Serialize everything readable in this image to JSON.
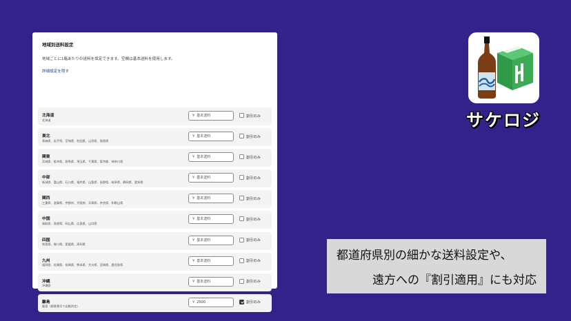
{
  "panel": {
    "title": "地域別送料設定",
    "description": "地域ごとに1箱あたりの送料を設定できます。空欄は基本送料を使用します。",
    "detail_link": "詳細設定を隠す",
    "currency_symbol": "¥",
    "checkbox_label": "割引のみ",
    "regions": [
      {
        "name": "北海道",
        "prefectures": "北海道",
        "placeholder": "基本送料",
        "value": "",
        "discount_only": false
      },
      {
        "name": "東北",
        "prefectures": "青森県、岩手県、宮城県、秋田県、山形県、福島県",
        "placeholder": "基本送料",
        "value": "",
        "discount_only": false
      },
      {
        "name": "関東",
        "prefectures": "茨城県、栃木県、群馬県、埼玉県、千葉県、東京都、神奈川県",
        "placeholder": "基本送料",
        "value": "",
        "discount_only": false
      },
      {
        "name": "中部",
        "prefectures": "新潟県、富山県、石川県、福井県、山梨県、長野県、岐阜県、静岡県、愛知県",
        "placeholder": "基本送料",
        "value": "",
        "discount_only": false
      },
      {
        "name": "関西",
        "prefectures": "三重県、滋賀県、京都府、大阪府、兵庫県、奈良県、和歌山県",
        "placeholder": "基本送料",
        "value": "",
        "discount_only": false
      },
      {
        "name": "中国",
        "prefectures": "鳥取県、島根県、岡山県、広島県、山口県",
        "placeholder": "基本送料",
        "value": "",
        "discount_only": false
      },
      {
        "name": "四国",
        "prefectures": "徳島県、香川県、愛媛県、高知県",
        "placeholder": "基本送料",
        "value": "",
        "discount_only": false
      },
      {
        "name": "九州",
        "prefectures": "福岡県、佐賀県、長崎県、熊本県、大分県、宮崎県、鹿児島県",
        "placeholder": "基本送料",
        "value": "",
        "discount_only": false
      },
      {
        "name": "沖縄",
        "prefectures": "沖縄県",
        "placeholder": "基本送料",
        "value": "",
        "discount_only": false
      },
      {
        "name": "離島",
        "prefectures": "離島（郵便番号で自動判定）",
        "placeholder": "基本送料",
        "value": "2500",
        "discount_only": true
      }
    ]
  },
  "brand": {
    "name": "サケロジ",
    "colors": {
      "bottle": "#7a3d16",
      "box": "#3daa55",
      "label": "#cfe3ef",
      "wave": "#1e5fa8"
    }
  },
  "caption": {
    "line1": "都道府県別の細かな送料設定や、",
    "line2": "遠方への『割引適用』にも対応"
  },
  "colors": {
    "background": "#33228a",
    "link": "#2a3f9e",
    "caption_bg": "#d8d8d8"
  }
}
